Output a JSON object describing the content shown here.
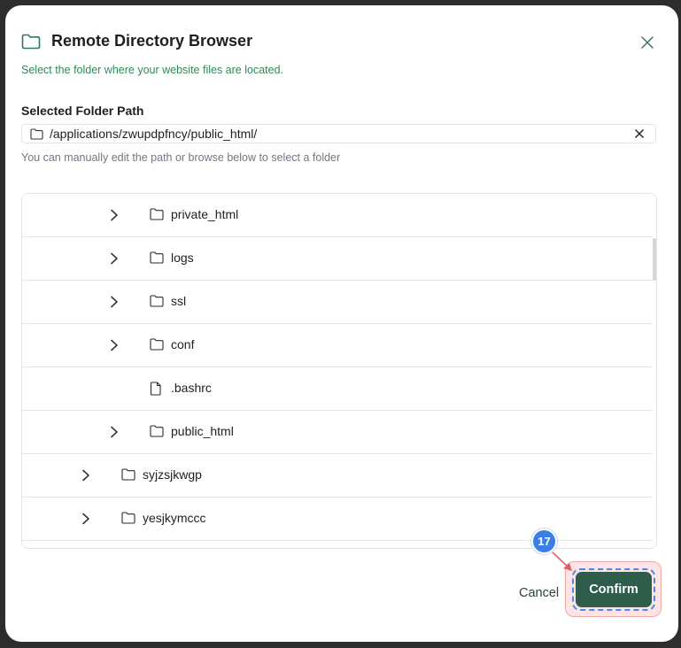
{
  "dialog": {
    "title": "Remote Directory Browser",
    "subtitle": "Select the folder where your website files are located.",
    "path_label": "Selected Folder Path",
    "path_value": "/applications/zwupdpfncy/public_html/",
    "hint": "You can manually edit the path or browse below to select a folder"
  },
  "tree": {
    "rows": [
      {
        "name": "private_html",
        "type": "folder",
        "expandable": true,
        "depth": 2
      },
      {
        "name": "logs",
        "type": "folder",
        "expandable": true,
        "depth": 2
      },
      {
        "name": "ssl",
        "type": "folder",
        "expandable": true,
        "depth": 2
      },
      {
        "name": "conf",
        "type": "folder",
        "expandable": true,
        "depth": 2
      },
      {
        "name": ".bashrc",
        "type": "file",
        "expandable": false,
        "depth": 2
      },
      {
        "name": "public_html",
        "type": "folder",
        "expandable": true,
        "depth": 2
      },
      {
        "name": "syjzsjkwgp",
        "type": "folder",
        "expandable": true,
        "depth": 1
      },
      {
        "name": "yesjkymccc",
        "type": "folder",
        "expandable": true,
        "depth": 1
      }
    ]
  },
  "footer": {
    "cancel_label": "Cancel",
    "confirm_label": "Confirm"
  },
  "annotation": {
    "step_number": "17"
  },
  "colors": {
    "primary": "#2e5d4c",
    "subtitle_green": "#2f8a56",
    "highlight": "#3b7fe6"
  }
}
